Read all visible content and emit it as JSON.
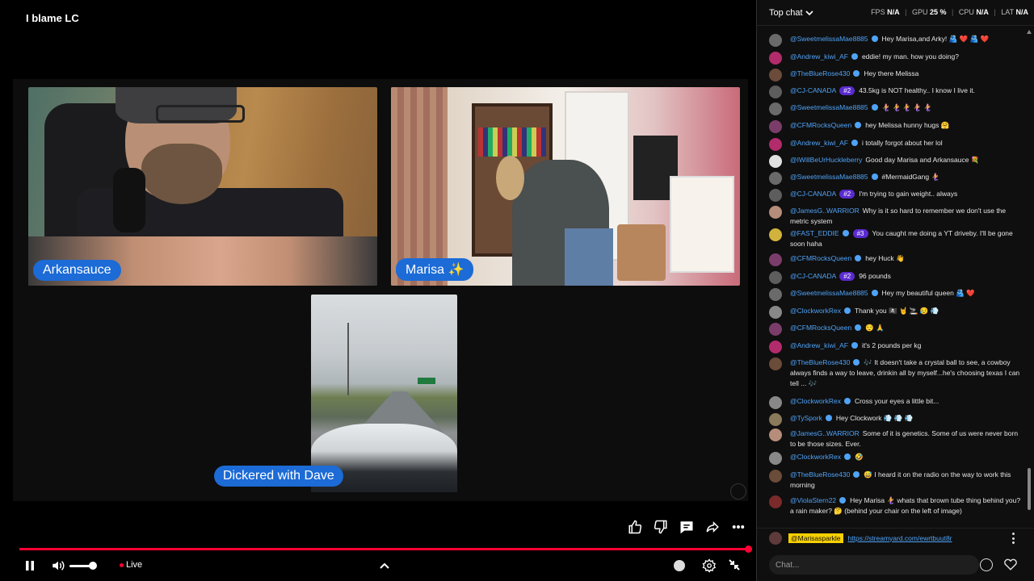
{
  "player": {
    "title": "I blame LC",
    "participants": [
      {
        "name": "Arkansauce"
      },
      {
        "name": "Marisa ✨"
      },
      {
        "name": "Dickered with Dave"
      }
    ],
    "live_label": "Live",
    "progress_fraction": 0.99,
    "volume_fraction": 0.75,
    "icons": {
      "like": "thumbs-up-icon",
      "dislike": "thumbs-down-icon",
      "chat": "chat-icon",
      "share": "share-icon",
      "more": "more-vertical-icon",
      "pause": "pause-icon",
      "volume": "volume-icon",
      "chevron": "chevron-up-icon",
      "captions": "captions-icon",
      "settings": "gear-icon",
      "exit": "exit-fullscreen-icon"
    },
    "accent": "#ff0033",
    "tag_color": "#1c6bd6"
  },
  "chat": {
    "mode": "Top chat",
    "stats": {
      "fps_label": "FPS",
      "fps_value": "N/A",
      "gpu_label": "GPU",
      "gpu_value": "25 %",
      "cpu_label": "CPU",
      "cpu_value": "N/A",
      "lat_label": "LAT",
      "lat_value": "N/A"
    },
    "messages": [
      {
        "author": "@SweetmelissaMae8885",
        "verified": true,
        "rank": "",
        "text": "Hey Marisa,and Arky! 🫂 ❤️ 🫂 ❤️",
        "avatar": "#6a6a6a"
      },
      {
        "author": "@Andrew_kiwi_AF",
        "verified": true,
        "rank": "",
        "text": "eddie! my man. how you doing?",
        "avatar": "#b22b6b"
      },
      {
        "author": "@TheBlueRose430",
        "verified": true,
        "rank": "",
        "text": "Hey there Melissa",
        "avatar": "#6b4b3a"
      },
      {
        "author": "@CJ-CANADA",
        "verified": false,
        "rank": "#2",
        "text": "43.5kg is NOT healthy.. I know I live it.",
        "avatar": "#5d5d5d"
      },
      {
        "author": "@SweetmelissaMae8885",
        "verified": true,
        "rank": "",
        "text": "🧜‍♀️ 🧜‍♀️ 🧜‍♀️ 🧜‍♀️ 🧜‍♀️",
        "avatar": "#6a6a6a"
      },
      {
        "author": "@CFMRocksQueen",
        "verified": true,
        "rank": "",
        "text": "hey Melissa hunny hugs 🤗",
        "avatar": "#7a3d6a"
      },
      {
        "author": "@Andrew_kiwi_AF",
        "verified": true,
        "rank": "",
        "text": "i totally forgot about her lol",
        "avatar": "#b22b6b"
      },
      {
        "author": "@IWillBeUrHuckleberry",
        "verified": false,
        "rank": "",
        "text": "Good day Marisa and Arkansauce 💐",
        "avatar": "#e0e0e0"
      },
      {
        "author": "@SweetmelissaMae8885",
        "verified": true,
        "rank": "",
        "text": "#MermaidGang 🧜‍♀️",
        "avatar": "#6a6a6a"
      },
      {
        "author": "@CJ-CANADA",
        "verified": false,
        "rank": "#2",
        "text": "I'm trying to gain weight.. always",
        "avatar": "#5d5d5d"
      },
      {
        "author": "@JamesG..WARRIOR",
        "verified": false,
        "rank": "",
        "text": "Why is it so hard to remember we don't use the metric system",
        "avatar": "#b68d7a"
      },
      {
        "author": "@FAST_EDDIE",
        "verified": true,
        "rank": "#3",
        "text": "You caught me doing a YT driveby. I'll be gone soon haha",
        "avatar": "#d1b23c"
      },
      {
        "author": "@CFMRocksQueen",
        "verified": true,
        "rank": "",
        "text": "hey Huck 👋",
        "avatar": "#7a3d6a"
      },
      {
        "author": "@CJ-CANADA",
        "verified": false,
        "rank": "#2",
        "text": "96 pounds",
        "avatar": "#5d5d5d"
      },
      {
        "author": "@SweetmelissaMae8885",
        "verified": true,
        "rank": "",
        "text": "Hey my beautiful queen 🫂 ❤️",
        "avatar": "#6a6a6a"
      },
      {
        "author": "@ClockworkRex",
        "verified": true,
        "rank": "",
        "text": "Thank you 🏴‍☠️ 🤘 🚬 😥 💨",
        "avatar": "#888"
      },
      {
        "author": "@CFMRocksQueen",
        "verified": true,
        "rank": "",
        "text": "😌 🙏",
        "avatar": "#7a3d6a"
      },
      {
        "author": "@Andrew_kiwi_AF",
        "verified": true,
        "rank": "",
        "text": "it's 2 pounds per kg",
        "avatar": "#b22b6b"
      },
      {
        "author": "@TheBlueRose430",
        "verified": true,
        "rank": "",
        "text": "🎶 It doesn't take a crystal ball to see, a cowboy always finds a way to leave, drinkin all by myself...he's choosing texas I can tell ... 🎶",
        "avatar": "#6b4b3a"
      },
      {
        "author": "@ClockworkRex",
        "verified": true,
        "rank": "",
        "text": "Cross your eyes a little bit...",
        "avatar": "#888"
      },
      {
        "author": "@TySpork",
        "verified": true,
        "rank": "",
        "text": "Hey Clockwork 💨 💨 💨",
        "avatar": "#8a7a5a"
      },
      {
        "author": "@JamesG..WARRIOR",
        "verified": false,
        "rank": "",
        "text": "Some of it is genetics. Some of us were never born to be those sizes. Ever.",
        "avatar": "#b68d7a"
      },
      {
        "author": "@ClockworkRex",
        "verified": true,
        "rank": "",
        "text": "🤣",
        "avatar": "#888"
      },
      {
        "author": "@TheBlueRose430",
        "verified": true,
        "rank": "",
        "text": "😅 I heard it on the radio on the way to work this morning",
        "avatar": "#6b4b3a"
      },
      {
        "author": "@ViolaStern22",
        "verified": true,
        "rank": "",
        "text": "Hey Marisa 🧜‍♀️ whats that brown tube thing behind you? a rain maker? 🤔 (behind your chair on the left of image)",
        "avatar": "#7a2a2a"
      }
    ],
    "pinned": {
      "user": "@Marisasparkle",
      "link": "https://streamyard.com/ewrtbuut8r"
    },
    "input_placeholder": "Chat..."
  }
}
